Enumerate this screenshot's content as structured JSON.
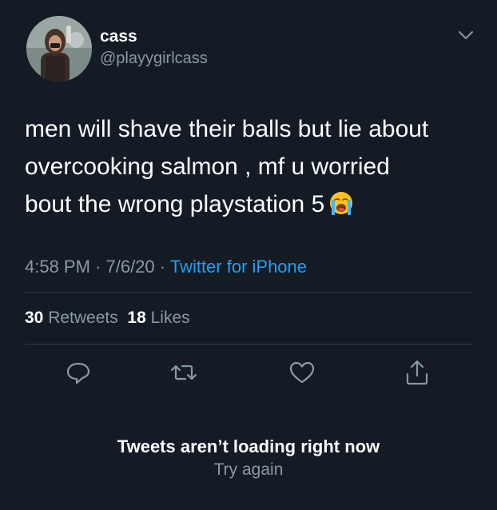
{
  "author": {
    "display_name": "cass",
    "handle": "@playygirlcass",
    "avatar_icon": "profile-photo"
  },
  "tweet": {
    "lines": [
      "men will shave their balls but lie about",
      "overcooking salmon , mf u worried",
      "bout the wrong playstation 5"
    ],
    "emoji": "loudly-crying-face"
  },
  "meta": {
    "time": "4:58 PM",
    "sep1": " · ",
    "date": "7/6/20",
    "sep2": " · ",
    "source": "Twitter for iPhone"
  },
  "stats": {
    "retweets_count": "30",
    "retweets_label": "Retweets",
    "likes_count": "18",
    "likes_label": "Likes"
  },
  "actions": [
    "reply-icon",
    "retweet-icon",
    "like-icon",
    "share-icon"
  ],
  "notice": {
    "title": "Tweets aren’t loading right now",
    "retry": "Try again"
  },
  "colors": {
    "background": "#141b25",
    "secondary_text": "#8899a6",
    "link": "#1da1f2",
    "divider": "#2f3a45"
  }
}
